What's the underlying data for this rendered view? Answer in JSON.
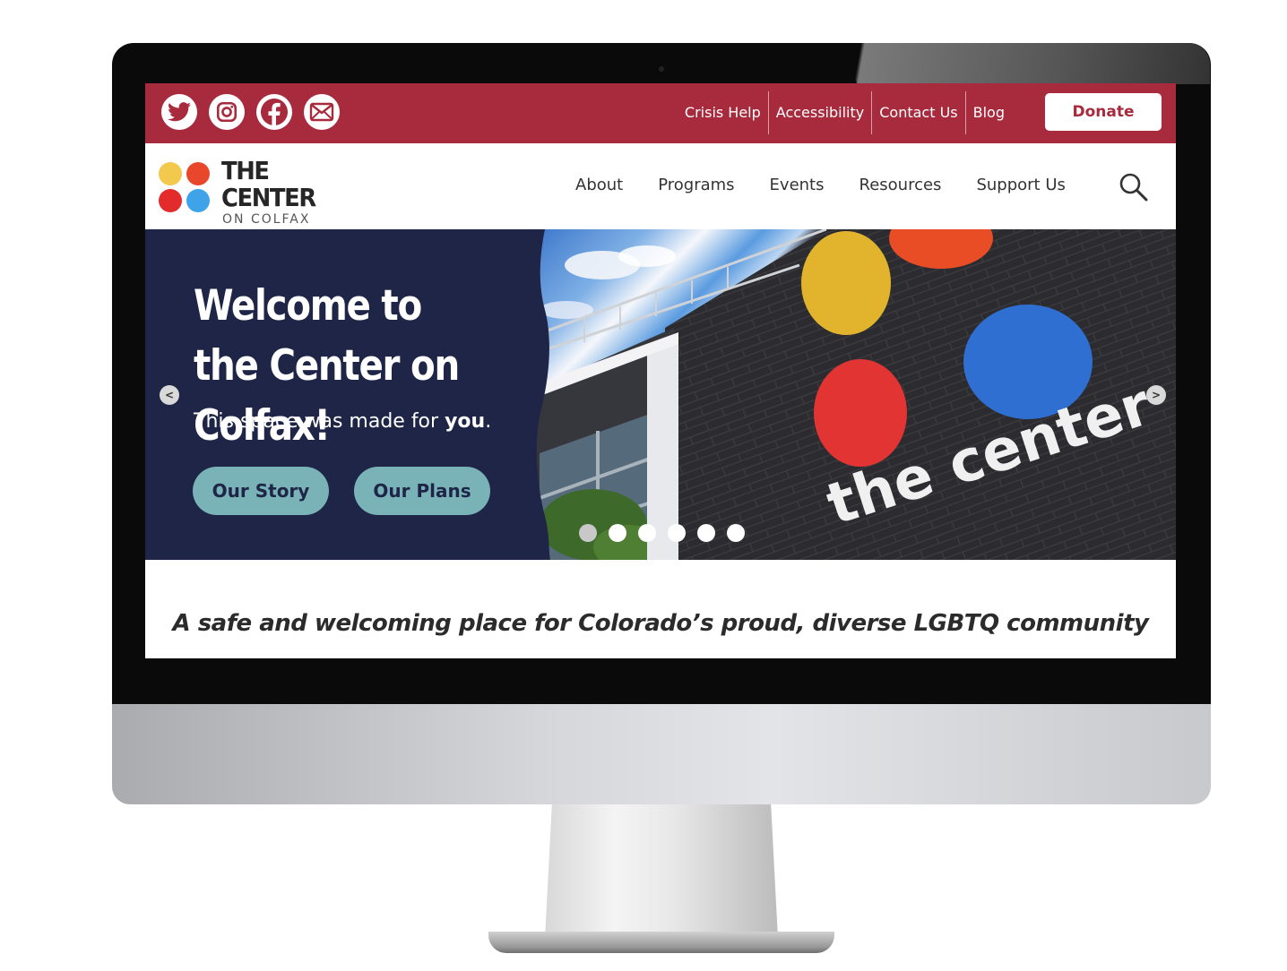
{
  "topbar": {
    "social": [
      {
        "icon": "twitter-icon"
      },
      {
        "icon": "instagram-icon"
      },
      {
        "icon": "facebook-icon"
      },
      {
        "icon": "email-icon"
      }
    ],
    "links": [
      "Crisis Help",
      "Accessibility",
      "Contact Us",
      "Blog"
    ],
    "donate_label": "Donate",
    "bg_color": "#a72a3d"
  },
  "logo": {
    "line1": "THE",
    "line2": "CENTER",
    "line3": "ON COLFAX",
    "dot_colors": [
      "#f2c94c",
      "#e8472b",
      "#e8472b",
      "#3fa3ea"
    ]
  },
  "nav": {
    "items": [
      "About",
      "Programs",
      "Events",
      "Resources",
      "Support Us"
    ],
    "search_icon": "search-icon"
  },
  "hero": {
    "title": "Welcome to the Center on Colfax!",
    "subtitle_prefix": "This space was made for ",
    "subtitle_emphasis": "you",
    "subtitle_suffix": ".",
    "buttons": [
      "Our Story",
      "Our Plans"
    ],
    "sign_text": "the center",
    "panel_color": "#1e2547",
    "button_color": "#7ab3b7",
    "prev_label": "<",
    "next_label": ">",
    "slide_count": 6,
    "active_slide": 1
  },
  "tagline": "A safe and welcoming place for Colorado’s proud, diverse LGBTQ community"
}
